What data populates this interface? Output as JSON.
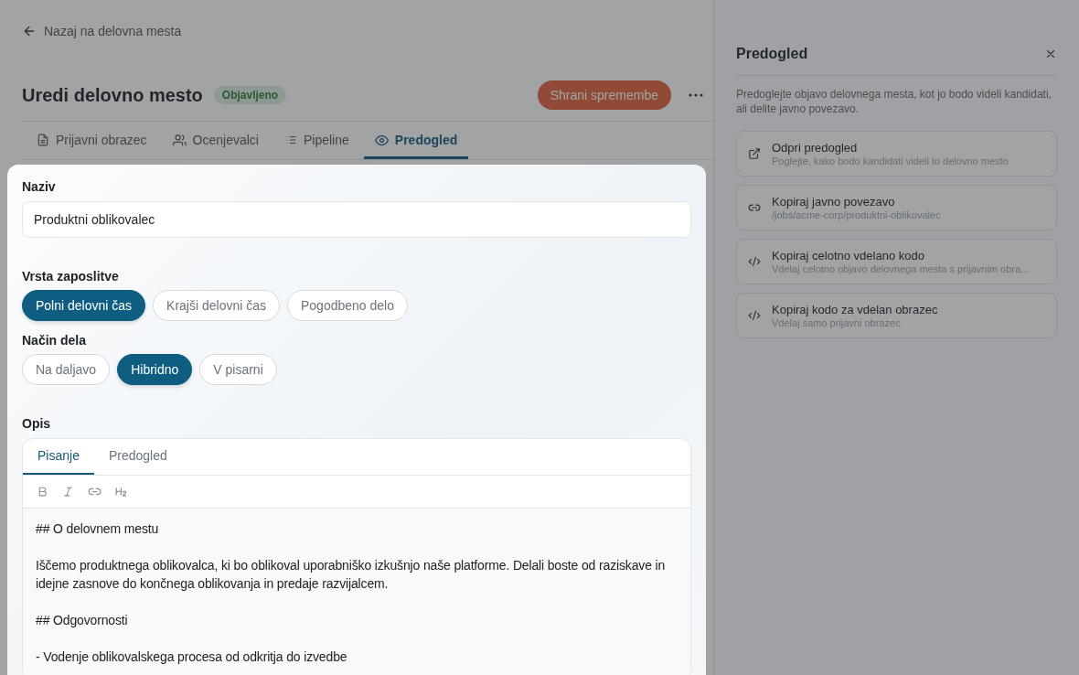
{
  "back_link": {
    "label": "Nazaj na delovna mesta"
  },
  "header": {
    "title": "Uredi delovno mesto",
    "status": "Objavljeno",
    "save_button": "Shrani spremembe"
  },
  "tabs": [
    {
      "label": "Prijavni obrazec",
      "kind": "form",
      "selected": false
    },
    {
      "label": "Ocenjevalci",
      "kind": "reviewers",
      "selected": false
    },
    {
      "label": "Pipeline",
      "kind": "pipeline",
      "selected": false
    },
    {
      "label": "Predogled",
      "kind": "preview",
      "selected": true
    }
  ],
  "form": {
    "name_label": "Naziv",
    "name_value": "Produktni oblikovalec",
    "groups": [
      {
        "label": "Vrsta zaposlitve",
        "options": [
          {
            "label": "Polni delovni čas",
            "selected": true
          },
          {
            "label": "Krajši delovni čas",
            "selected": false
          },
          {
            "label": "Pogodbeno delo",
            "selected": false
          }
        ]
      },
      {
        "label": "Način dela",
        "options": [
          {
            "label": "Na daljavo",
            "selected": false
          },
          {
            "label": "Hibridno",
            "selected": true
          },
          {
            "label": "V pisarni",
            "selected": false
          }
        ]
      }
    ],
    "description_label": "Opis",
    "editor_tabs": [
      {
        "label": "Pisanje",
        "selected": true
      },
      {
        "label": "Predogled",
        "selected": false
      }
    ],
    "toolbar": [
      {
        "kind": "bold"
      },
      {
        "kind": "italic"
      },
      {
        "kind": "link"
      },
      {
        "kind": "heading"
      }
    ],
    "content": [
      "## O delovnem mestu",
      "Iščemo produktnega oblikovalca, ki bo oblikoval uporabniško izkušnjo naše platforme. Delali boste od raziskave in idejne zasnove do končnega oblikovanja in predaje razvijalcem.",
      "## Odgovornosti",
      "- Vodenje oblikovalskega procesa od odkritja do izvedbe"
    ]
  },
  "preview_panel": {
    "title": "Predogled",
    "description": "Predoglejte objavo delovnega mesta, kot jo bodo videli kandidati, ali delite javno povezavo.",
    "actions": [
      {
        "kind": "external",
        "title": "Odpri predogled",
        "subtitle": "Poglejte, kako bodo kandidati videli to delovno mesto"
      },
      {
        "kind": "link",
        "title": "Kopiraj javno povezavo",
        "subtitle": "/jobs/acme-corp/produktni-oblikovalec"
      },
      {
        "kind": "code",
        "title": "Kopiraj celotno vdelano kodo",
        "subtitle": "Vdelaj celotno objavo delovnega mesta s prijavnim obra..."
      },
      {
        "kind": "code",
        "title": "Kopiraj kodo za vdelan obrazec",
        "subtitle": "Vdelaj samo prijavni obrazec"
      }
    ]
  }
}
